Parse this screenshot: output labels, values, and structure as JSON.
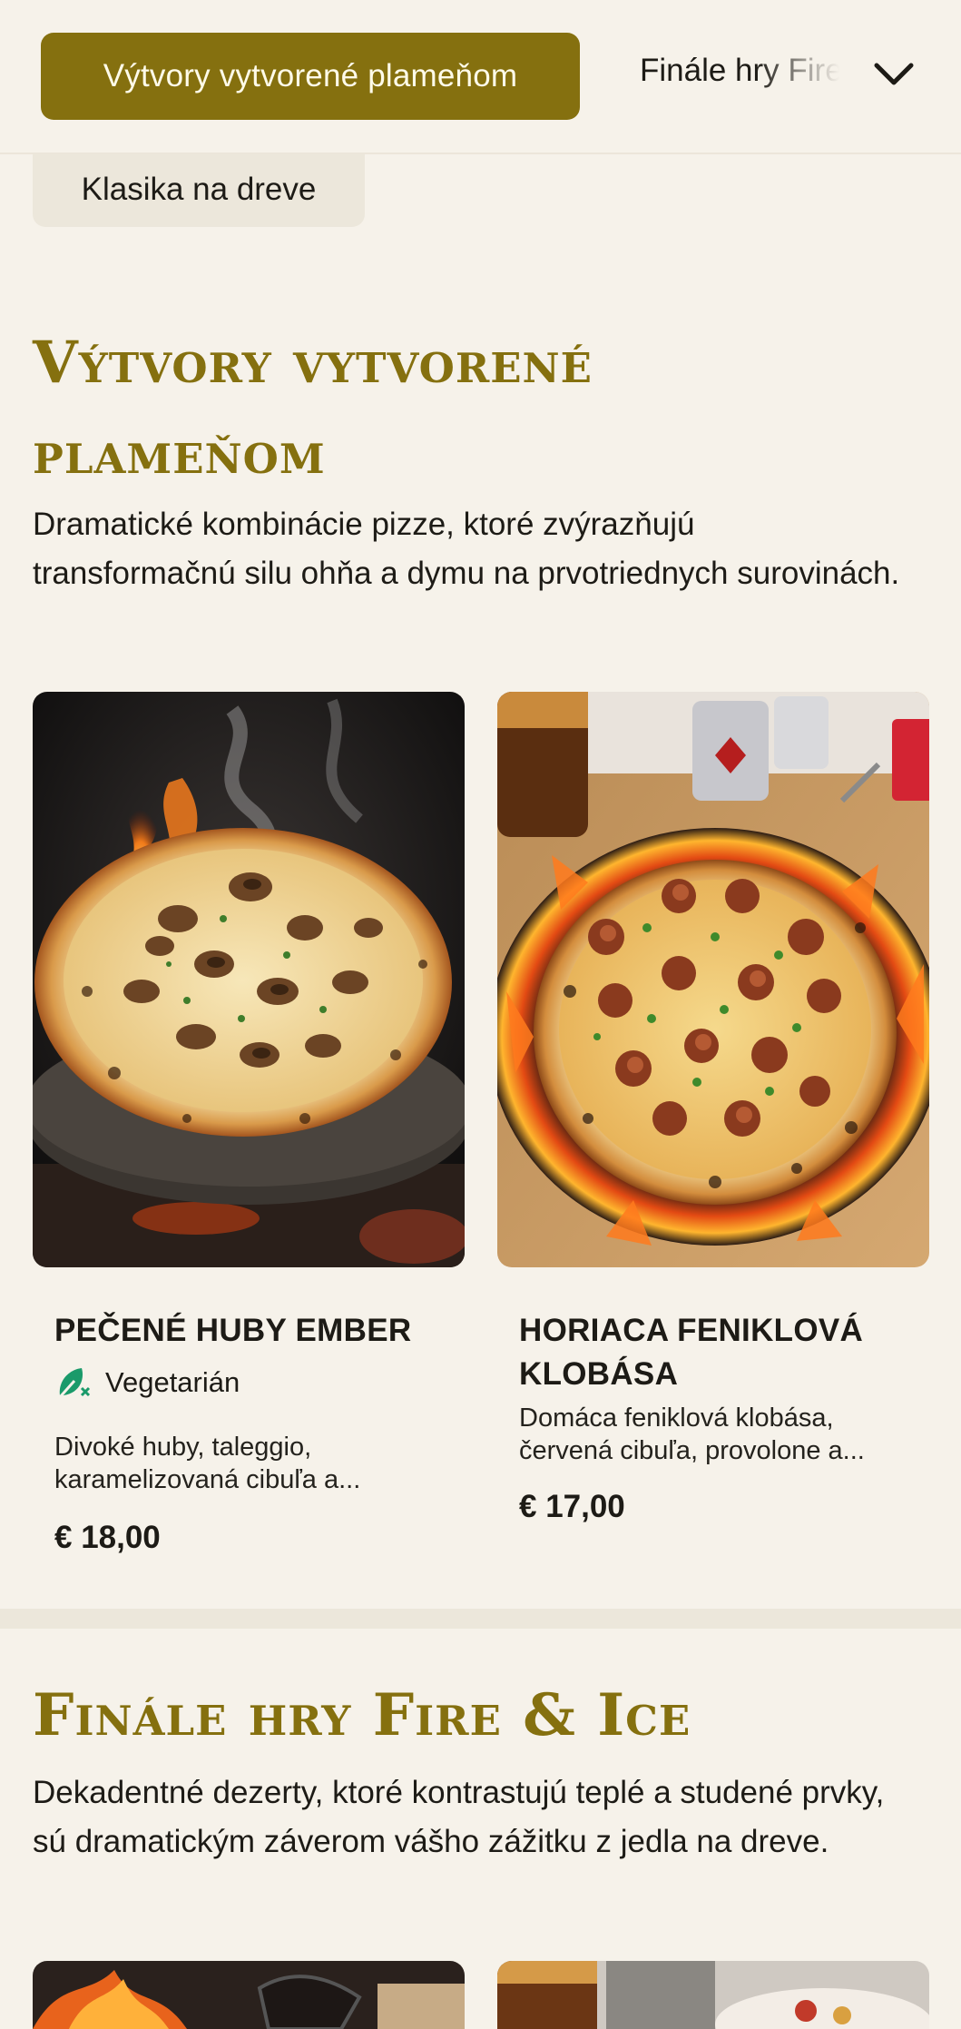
{
  "nav": {
    "active_category": "Výtvory vytvorené plameňom",
    "next_category": "Finále hry Fire & Ice",
    "second_category": "Klasika na dreve",
    "chevron_icon": "chevron-down-icon"
  },
  "sections": [
    {
      "title_line1": "Výtvory vytvorené",
      "title_line2": "plameňom",
      "description": "Dramatické kombinácie pizze, ktoré zvýrazňujú transformačnú silu ohňa a dymu na prvotriednych surovinách.",
      "items": [
        {
          "name": "PEČENÉ HUBY EMBER",
          "tag": "Vegetarián",
          "tag_icon": "vegetarian-leaf-icon",
          "description": "Divoké huby, taleggio, karamelizovaná cibuľa a...",
          "price": "€ 18,00"
        },
        {
          "name": "HORIACA FENIKLOVÁ KLOBÁSA",
          "description": "Domáca feniklová klobása, červená cibuľa, provolone a...",
          "price": "€ 17,00"
        }
      ]
    },
    {
      "title": "Finále hry Fire & Ice",
      "description": "Dekadentné dezerty, ktoré kontrastujú teplé a studené prvky, sú dramatickým záverom vášho zážitku z jedla na dreve."
    }
  ],
  "colors": {
    "accent": "#85700f",
    "background": "#f6f2ea",
    "pill_bg": "#ece7db",
    "vegetarian": "#1a9a6a"
  }
}
